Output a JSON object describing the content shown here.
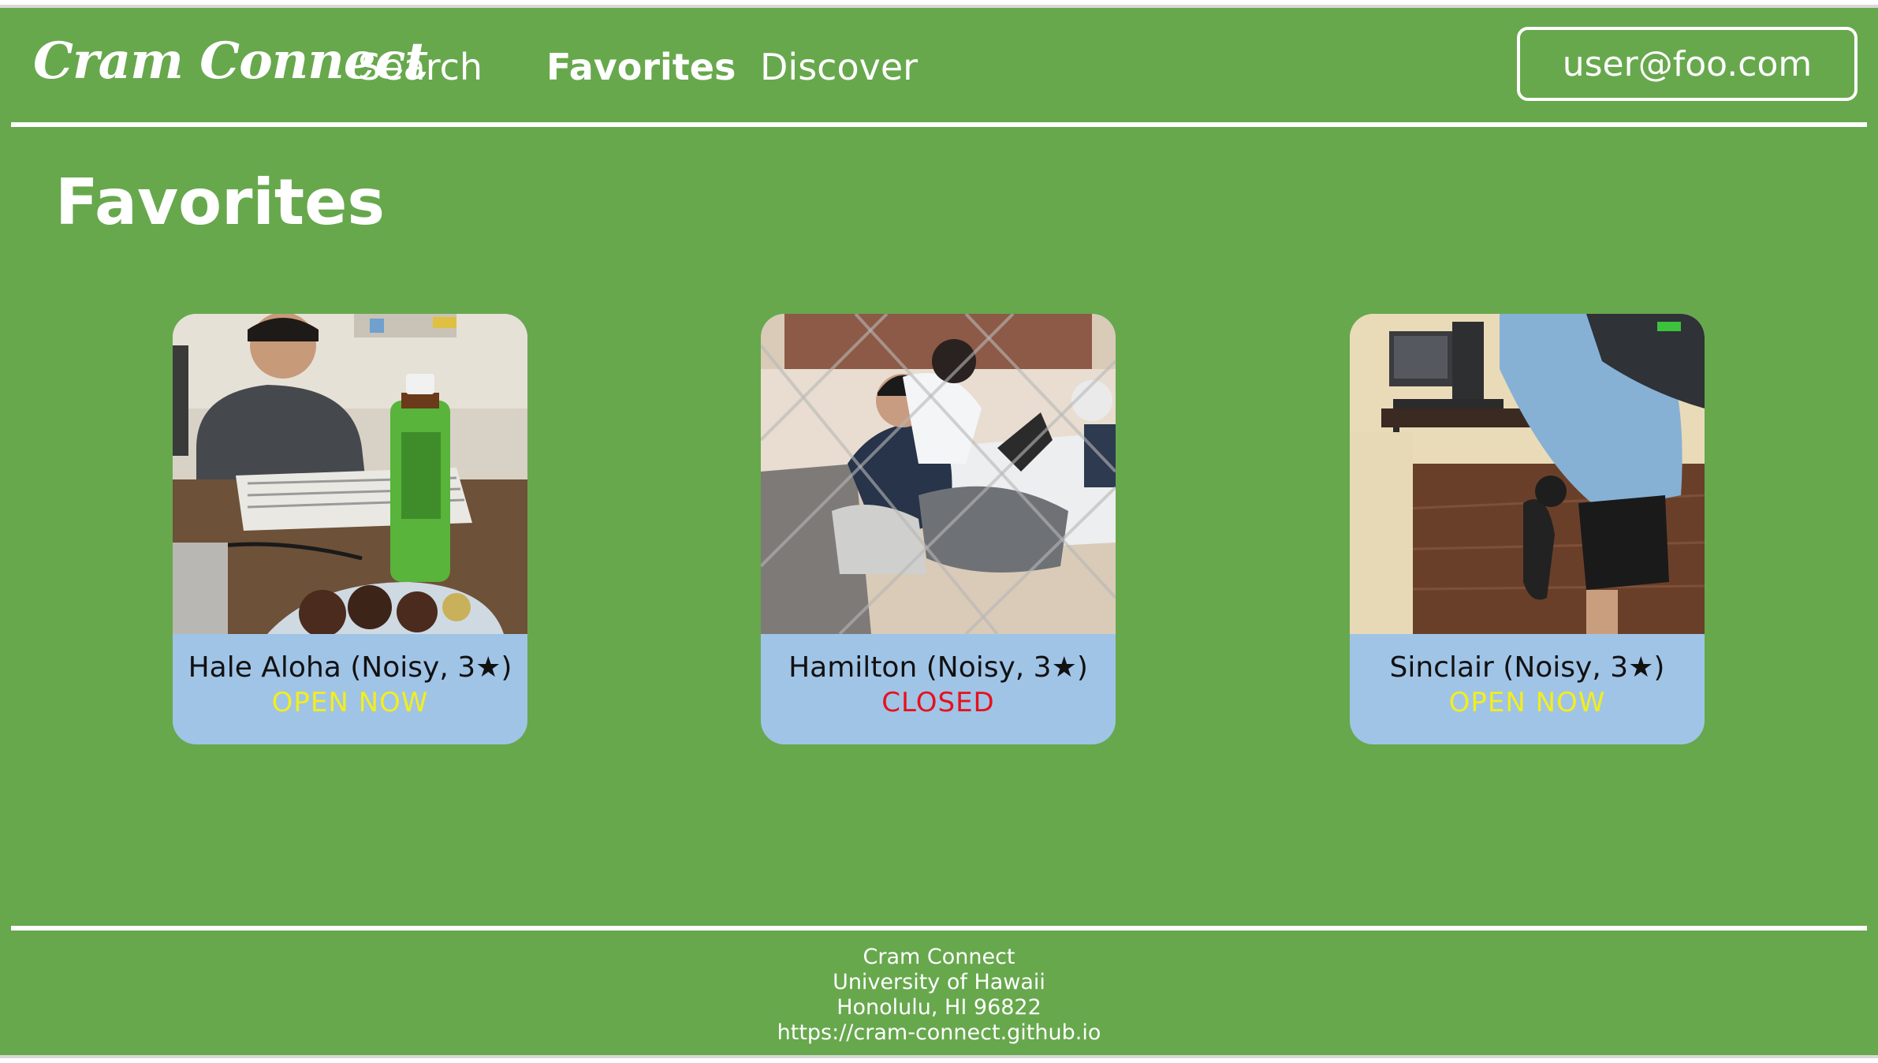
{
  "navbar": {
    "brand": "Cram Connect",
    "links": [
      {
        "label": "Search",
        "active": false
      },
      {
        "label": "Favorites",
        "active": true
      },
      {
        "label": "Discover",
        "active": false
      }
    ],
    "user_label": "user@foo.com"
  },
  "page": {
    "title": "Favorites"
  },
  "cards": [
    {
      "name": "Hale Aloha (Noisy, 3★)",
      "status": "OPEN NOW",
      "status_color": "#f2ee1e"
    },
    {
      "name": "Hamilton (Noisy, 3★)",
      "status": "CLOSED",
      "status_color": "#e8101c"
    },
    {
      "name": "Sinclair (Noisy, 3★)",
      "status": "OPEN NOW",
      "status_color": "#f2ee1e"
    }
  ],
  "footer": {
    "lines": [
      "Cram Connect",
      "University of Hawaii",
      "Honolulu, HI 96822",
      "https://cram-connect.github.io"
    ]
  },
  "colors": {
    "background": "#67a84d",
    "card_caption": "#a0c4e6",
    "open": "#f2ee1e",
    "closed": "#e8101c",
    "text_light": "#ffffff"
  }
}
